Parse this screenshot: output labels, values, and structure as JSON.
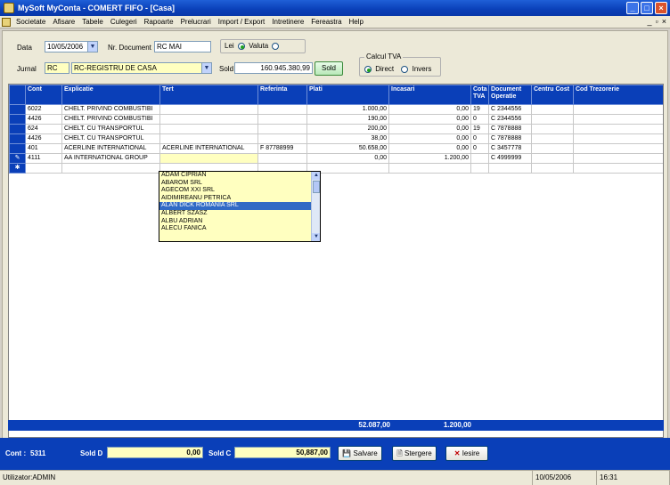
{
  "window": {
    "title": "MySoft MyConta - COMERT FIFO - [Casa]"
  },
  "menu": [
    "Societate",
    "Afisare",
    "Tabele",
    "Culegeri",
    "Rapoarte",
    "Prelucrari",
    "Import / Export",
    "Intretinere",
    "Fereastra",
    "Help"
  ],
  "form": {
    "data_label": "Data",
    "data_value": "10/05/2006",
    "nr_doc_label": "Nr. Document",
    "nr_doc_value": "RC MAI",
    "currency_lei": "Lei",
    "currency_valuta": "Valuta",
    "jurnal_label": "Jurnal",
    "jurnal_code": "RC",
    "jurnal_name": "RC-REGISTRU DE CASA",
    "sold_label": "Sold",
    "sold_value": "160.945.380,99",
    "sold_button": "Sold",
    "tva_group_label": "Calcul TVA",
    "tva_direct": "Direct",
    "tva_invers": "Invers"
  },
  "grid": {
    "columns": [
      "Cont",
      "Explicatie",
      "Tert",
      "Referinta",
      "Plati",
      "Incasari",
      "Cota TVA",
      "Document Operatie",
      "Centru Cost",
      "Cod Trezorerie"
    ],
    "rows": [
      {
        "ind": "",
        "cont": "6022",
        "explicatie": "CHELT. PRIVIND COMBUSTIBI",
        "tert": "",
        "referinta": "",
        "plati": "1.000,00",
        "incasari": "0,00",
        "cota": "19",
        "document": "C 2344556",
        "centru": "",
        "cod": ""
      },
      {
        "ind": "",
        "cont": "4426",
        "explicatie": "CHELT. PRIVIND COMBUSTIBI",
        "tert": "",
        "referinta": "",
        "plati": "190,00",
        "incasari": "0,00",
        "cota": "0",
        "document": "C 2344556",
        "centru": "",
        "cod": ""
      },
      {
        "ind": "",
        "cont": "624",
        "explicatie": "CHELT. CU TRANSPORTUL",
        "tert": "",
        "referinta": "",
        "plati": "200,00",
        "incasari": "0,00",
        "cota": "19",
        "document": "C 7878888",
        "centru": "",
        "cod": ""
      },
      {
        "ind": "",
        "cont": "4426",
        "explicatie": "CHELT. CU TRANSPORTUL",
        "tert": "",
        "referinta": "",
        "plati": "38,00",
        "incasari": "0,00",
        "cota": "0",
        "document": "C 7878888",
        "centru": "",
        "cod": ""
      },
      {
        "ind": "",
        "cont": "401",
        "explicatie": "ACERLINE INTERNATIONAL",
        "tert": "ACERLINE INTERNATIONAL",
        "referinta": "F 87788999",
        "plati": "50.658,00",
        "incasari": "0,00",
        "cota": "0",
        "document": "C 3457778",
        "centru": "",
        "cod": ""
      },
      {
        "ind": "✎",
        "cont": "4111",
        "explicatie": "AA INTERNATIONAL GROUP",
        "tert": "",
        "referinta": "",
        "plati": "0,00",
        "incasari": "1.200,00",
        "cota": "",
        "document": "C 4999999",
        "centru": "",
        "cod": ""
      },
      {
        "ind": "✱",
        "cont": "",
        "explicatie": "",
        "tert": "",
        "referinta": "",
        "plati": "",
        "incasari": "",
        "cota": "",
        "document": "",
        "centru": "",
        "cod": ""
      }
    ],
    "dropdown_options": [
      "ADAM CIPRIAN",
      "ABAROM SRL",
      "AGECOM XXI SRL",
      "AIDIMIREANU PETRICA",
      "ALAN DICK ROMANIA SRL",
      "ALBERT SZASZ",
      "ALBU ADRIAN",
      "ALECU FANICA"
    ],
    "dropdown_selected": 4,
    "totals": {
      "plati": "52.087,00",
      "incasari": "1.200,00"
    }
  },
  "bottom": {
    "cont_label": "Cont :",
    "cont_value": "5311",
    "sold_d_label": "Sold D",
    "sold_d_value": "0,00",
    "sold_c_label": "Sold C",
    "sold_c_value": "50,887,00",
    "save": "Salvare",
    "delete": "Stergere",
    "exit": "Iesire"
  },
  "status": {
    "user": "Utilizator:ADMIN",
    "date": "10/05/2006",
    "time": "16:31"
  },
  "colors": {
    "accent": "#0a3fb8",
    "edit_bg": "#ffffc0",
    "selected": "#316ac5"
  }
}
